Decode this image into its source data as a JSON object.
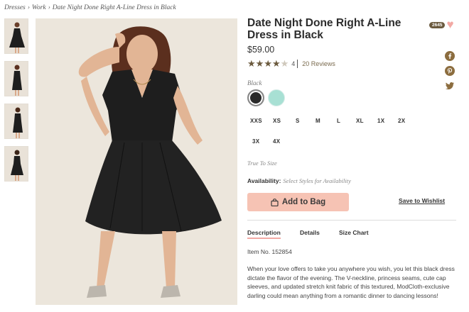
{
  "breadcrumb": {
    "items": [
      "Dresses",
      "Work",
      "Date Night Done Right A-Line Dress in Black"
    ],
    "separator": "›"
  },
  "product": {
    "title": "Date Night Done Right A-Line Dress in Black",
    "price": "$59.00",
    "love_count": "2645",
    "rating": {
      "value": 4,
      "max": 5,
      "count": "4",
      "reviews_label": "20 Reviews"
    },
    "color_label": "Black",
    "colors": [
      {
        "name": "black",
        "hex": "#2a2a2a"
      },
      {
        "name": "mint",
        "hex": "#a8e0d4"
      }
    ],
    "sizes": [
      "XXS",
      "XS",
      "S",
      "M",
      "L",
      "XL",
      "1X",
      "2X",
      "3X",
      "4X"
    ],
    "true_to_size": "True To Size",
    "availability_label": "Availability:",
    "availability_value": "Select Styles for Availability",
    "add_to_bag": "Add to Bag",
    "save_to_wishlist": "Save to Wishlist",
    "tabs": [
      "Description",
      "Details",
      "Size Chart"
    ],
    "item_no": "Item No. 152854",
    "description": "When your love offers to take you anywhere you wish, you let this black dress dictate the flavor of the evening. The V-neckline, princess seams, cute cap sleeves, and updated stretch knit fabric of this textured, ModCloth-exclusive darling could mean anything from a romantic dinner to dancing lessons!"
  },
  "social_icons": [
    "facebook-icon",
    "pinterest-icon",
    "twitter-icon"
  ],
  "colors": {
    "accent_brown": "#6b5a3e",
    "button_peach": "#f6c3b4",
    "heart_pink": "#f2a9a4",
    "image_bg": "#ece6dc"
  }
}
